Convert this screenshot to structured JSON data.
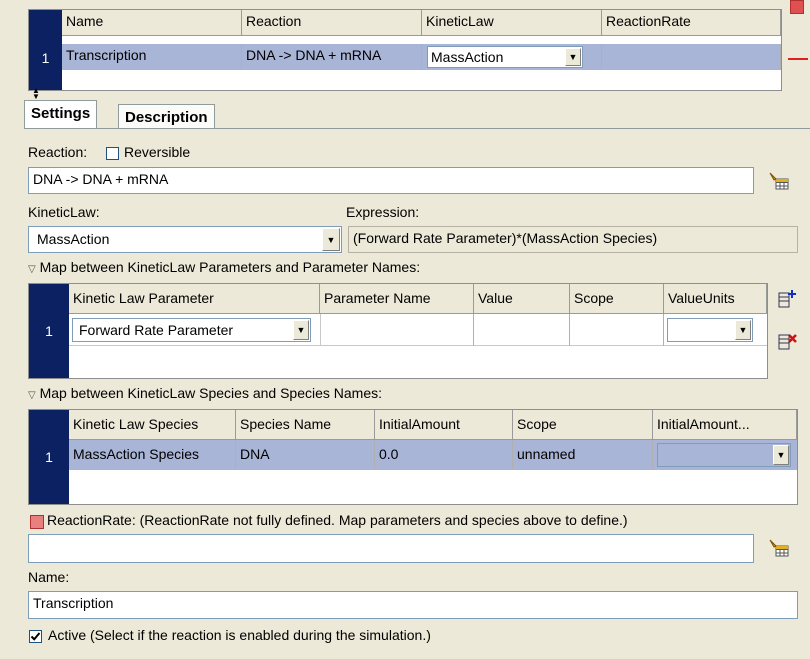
{
  "top_grid": {
    "headers": [
      "Name",
      "Reaction",
      "KineticLaw",
      "ReactionRate"
    ],
    "row_number": "1",
    "row": {
      "name": "Transcription",
      "reaction": "DNA -> DNA + mRNA",
      "kinetic_law": "MassAction",
      "reaction_rate": ""
    }
  },
  "tabs": [
    "Settings",
    "Description"
  ],
  "reaction": {
    "label": "Reaction:",
    "reversible_label": "Reversible",
    "reversible_checked": false,
    "equation": "DNA -> DNA + mRNA"
  },
  "kinetic": {
    "label": "KineticLaw:",
    "value": "MassAction",
    "expression_label": "Expression:",
    "expression": "(Forward Rate Parameter)*(MassAction Species)"
  },
  "param_map": {
    "title": "Map between KineticLaw Parameters and Parameter Names:",
    "headers": [
      "Kinetic Law Parameter",
      "Parameter Name",
      "Value",
      "Scope",
      "ValueUnits"
    ],
    "row_number": "1",
    "row": {
      "parameter": "Forward Rate Parameter",
      "name": "",
      "value": "",
      "scope": "",
      "units": ""
    }
  },
  "species_map": {
    "title": "Map between KineticLaw Species and Species Names:",
    "headers": [
      "Kinetic Law Species",
      "Species Name",
      "InitialAmount",
      "Scope",
      "InitialAmount..."
    ],
    "row_number": "1",
    "row": {
      "species": "MassAction Species",
      "name": "DNA",
      "amount": "0.0",
      "scope": "unnamed",
      "units": ""
    }
  },
  "rate": {
    "label": "ReactionRate: (ReactionRate not fully defined. Map parameters and species above to define.)",
    "value": ""
  },
  "name": {
    "label": "Name:",
    "value": "Transcription"
  },
  "active": {
    "label": "Active (Select if the reaction is enabled during the simulation.)",
    "checked": true
  },
  "colors": {
    "row_number_bg": "#0b2161",
    "selected_row": "#a9b5d6",
    "error_red": "#e05050"
  }
}
